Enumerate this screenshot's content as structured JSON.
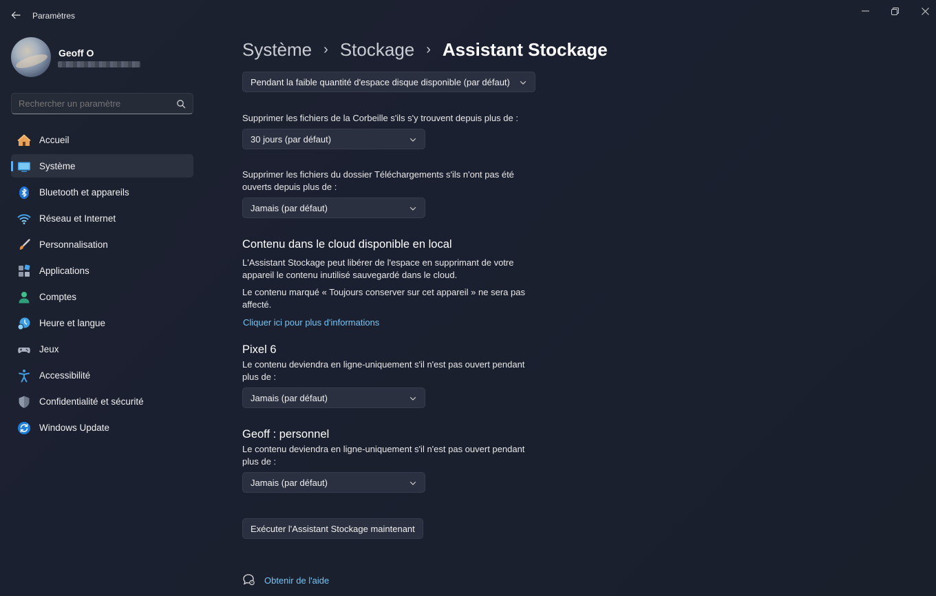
{
  "window": {
    "title": "Paramètres",
    "back_icon": "back-arrow-icon",
    "controls": [
      "minimize-icon",
      "maximize-icon",
      "close-icon"
    ]
  },
  "profile": {
    "name": "Geoff O"
  },
  "search": {
    "placeholder": "Rechercher un paramètre"
  },
  "sidebar": {
    "items": [
      {
        "label": "Accueil",
        "icon": "home-icon",
        "active": false
      },
      {
        "label": "Système",
        "icon": "monitor-icon",
        "active": true
      },
      {
        "label": "Bluetooth et appareils",
        "icon": "bluetooth-icon",
        "active": false
      },
      {
        "label": "Réseau et Internet",
        "icon": "wifi-icon",
        "active": false
      },
      {
        "label": "Personnalisation",
        "icon": "paintbrush-icon",
        "active": false
      },
      {
        "label": "Applications",
        "icon": "apps-icon",
        "active": false
      },
      {
        "label": "Comptes",
        "icon": "person-icon",
        "active": false
      },
      {
        "label": "Heure et langue",
        "icon": "clock-globe-icon",
        "active": false
      },
      {
        "label": "Jeux",
        "icon": "gamepad-icon",
        "active": false
      },
      {
        "label": "Accessibilité",
        "icon": "accessibility-icon",
        "active": false
      },
      {
        "label": "Confidentialité et sécurité",
        "icon": "shield-icon",
        "active": false
      },
      {
        "label": "Windows Update",
        "icon": "update-icon",
        "active": false
      }
    ]
  },
  "breadcrumb": {
    "items": [
      "Système",
      "Stockage",
      "Assistant Stockage"
    ]
  },
  "main": {
    "run_frequency_dropdown": "Pendant la faible quantité d'espace disque disponible (par défaut)",
    "recycle_label": "Supprimer les fichiers de la Corbeille s'ils s'y trouvent depuis plus de :",
    "recycle_dropdown": "30 jours (par défaut)",
    "downloads_label": "Supprimer les fichiers du dossier Téléchargements s'ils n'ont pas été ouverts depuis plus de :",
    "downloads_dropdown": "Jamais (par défaut)",
    "cloud_title": "Contenu dans le cloud disponible en local",
    "cloud_desc1": "L'Assistant Stockage peut libérer de l'espace en supprimant de votre appareil le contenu inutilisé sauvegardé dans le cloud.",
    "cloud_desc2": "Le contenu marqué « Toujours conserver sur cet appareil » ne sera pas affecté.",
    "cloud_link": "Cliquer ici pour plus d'informations",
    "pixel_title": "Pixel 6",
    "pixel_label": "Le contenu deviendra en ligne-uniquement s'il n'est pas ouvert pendant plus de :",
    "pixel_dropdown": "Jamais (par défaut)",
    "geoff_title": "Geoff : personnel",
    "geoff_label": "Le contenu deviendra en ligne-uniquement s'il n'est pas ouvert pendant plus de :",
    "geoff_dropdown": "Jamais (par défaut)",
    "run_button": "Exécuter l'Assistant Stockage maintenant",
    "help_link": "Obtenir de l'aide"
  },
  "colors": {
    "accent": "#5fb2f2",
    "link": "#75c4f5",
    "background": "#1c2130"
  }
}
